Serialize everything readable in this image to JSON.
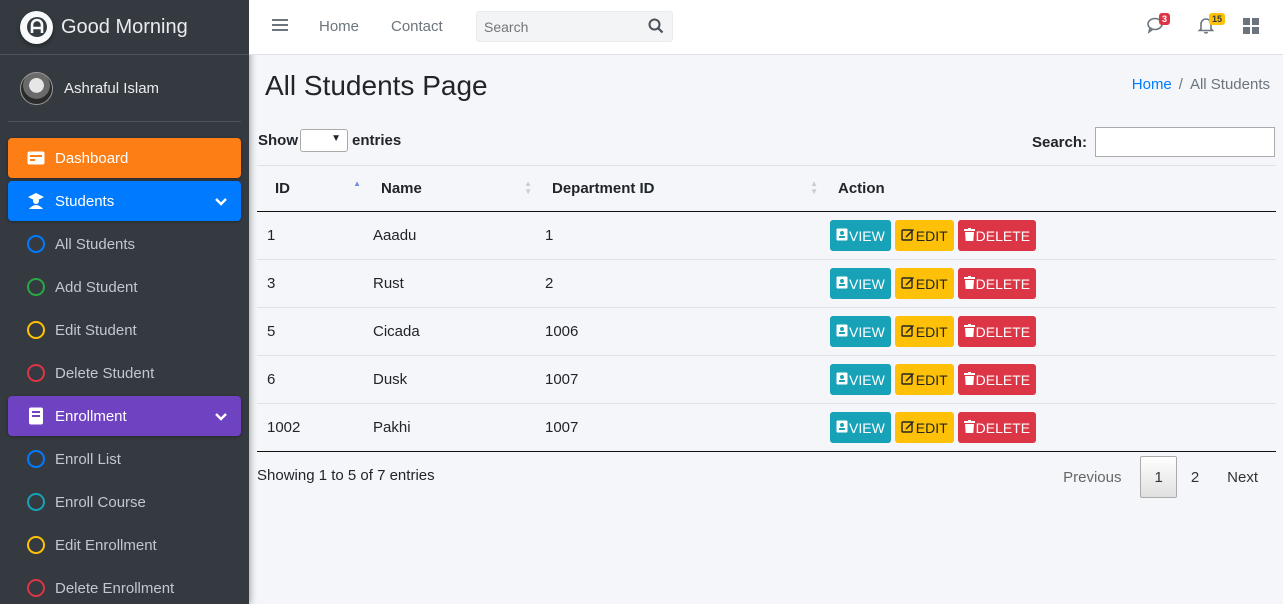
{
  "brand": {
    "name": "Good Morning"
  },
  "user": {
    "name": "Ashraful Islam"
  },
  "sidebar": {
    "items": [
      {
        "label": "Dashboard"
      },
      {
        "label": "Students"
      },
      {
        "label": "All Students",
        "color": "#007bff"
      },
      {
        "label": "Add Student",
        "color": "#28a745"
      },
      {
        "label": "Edit Student",
        "color": "#ffc107"
      },
      {
        "label": "Delete Student",
        "color": "#dc3545"
      },
      {
        "label": "Enrollment"
      },
      {
        "label": "Enroll List",
        "color": "#007bff"
      },
      {
        "label": "Enroll Course",
        "color": "#17a2b8"
      },
      {
        "label": "Edit Enrollment",
        "color": "#ffc107"
      },
      {
        "label": "Delete Enrollment",
        "color": "#dc3545"
      }
    ]
  },
  "topbar": {
    "home": "Home",
    "contact": "Contact",
    "search_placeholder": "Search",
    "messages_count": "3",
    "notifications_count": "15"
  },
  "page": {
    "title": "All Students Page",
    "breadcrumb_home": "Home",
    "breadcrumb_sep": "/",
    "breadcrumb_current": "All Students"
  },
  "table": {
    "show_label": "Show",
    "entries_label": "entries",
    "search_label": "Search:",
    "columns": [
      "ID",
      "Name",
      "Department ID",
      "Action"
    ],
    "rows": [
      {
        "id": "1",
        "name": "Aaadu",
        "dept": "1"
      },
      {
        "id": "3",
        "name": "Rust",
        "dept": "2"
      },
      {
        "id": "5",
        "name": "Cicada",
        "dept": "1006"
      },
      {
        "id": "6",
        "name": "Dusk",
        "dept": "1007"
      },
      {
        "id": "1002",
        "name": "Pakhi",
        "dept": "1007"
      }
    ],
    "btn_view": "VIEW",
    "btn_edit": "EDIT",
    "btn_delete": "DELETE",
    "info": "Showing 1 to 5 of 7 entries",
    "pagination": {
      "previous": "Previous",
      "page1": "1",
      "page2": "2",
      "next": "Next"
    }
  }
}
